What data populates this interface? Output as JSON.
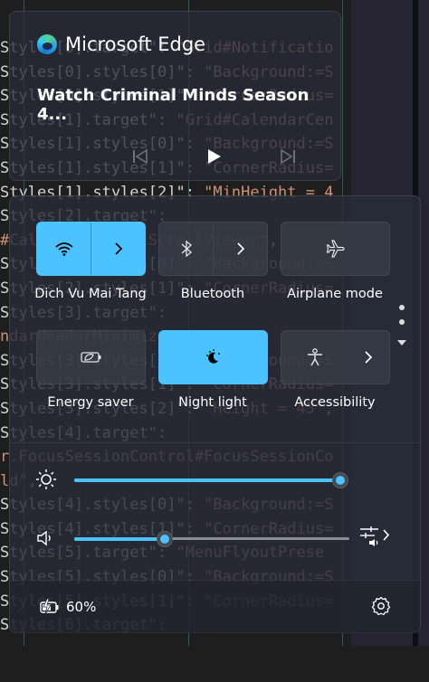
{
  "background_editor": {
    "lines": [
      [
        {
          "t": "Styles[0].target\": ",
          "c": "w"
        },
        {
          "t": "\"Grid#Notificatio",
          "c": "o"
        }
      ],
      [
        {
          "t": "Styles[0].styles[0]\": ",
          "c": "w"
        },
        {
          "t": "\"Background:=S",
          "c": "o"
        }
      ],
      [
        {
          "t": "Styles[0].styles[1]\": ",
          "c": "w"
        },
        {
          "t": "\"CornerRadius=",
          "c": "o"
        }
      ],
      [
        {
          "t": "Styles[1].target\": ",
          "c": "w"
        },
        {
          "t": "\"Grid#CalendarCen",
          "c": "o"
        }
      ],
      [
        {
          "t": "Styles[1].styles[0]\": ",
          "c": "w"
        },
        {
          "t": "\"Background:=S",
          "c": "o"
        }
      ],
      [
        {
          "t": "Styles[1].styles[1]\": ",
          "c": "w"
        },
        {
          "t": "\"CornerRadius=",
          "c": "o"
        }
      ],
      [
        {
          "t": "Styles[1].styles[2]\": ",
          "c": "w"
        },
        {
          "t": "\"MinHeight = 4",
          "c": "o"
        }
      ],
      [
        {
          "t": "Styles[2].target\":",
          "c": "w"
        }
      ],
      [
        {
          "t": "#CalendarControlScrollViewer\"",
          "c": "o"
        },
        {
          "t": ",",
          "c": "w"
        }
      ],
      [
        {
          "t": "Styles[2].styles[0]\": ",
          "c": "w"
        },
        {
          "t": "\"Background:=S",
          "c": "o"
        }
      ],
      [
        {
          "t": "Styles[2].styles[1]\": ",
          "c": "w"
        },
        {
          "t": "\"CornerRadius=",
          "c": "o"
        }
      ],
      [
        {
          "t": "Styles[3].target\":",
          "c": "w"
        }
      ],
      [
        {
          "t": "ndarHeaderMinimiz",
          "c": "o"
        }
      ],
      [
        {
          "t": "Styles[3].styles[0]\": ",
          "c": "w"
        },
        {
          "t": "\"Background:=S",
          "c": "o"
        }
      ],
      [
        {
          "t": "Styles[3].styles[1]\": ",
          "c": "w"
        },
        {
          "t": "\"CornerRadius=",
          "c": "o"
        }
      ],
      [
        {
          "t": "Styles[3].styles[2]\": ",
          "c": "w"
        },
        {
          "t": "\"Height = 45\"",
          "c": "o"
        },
        {
          "t": ",",
          "c": "w"
        }
      ],
      [
        {
          "t": "Styles[4].target\":",
          "c": "w"
        }
      ],
      [
        {
          "t": "r.FocusSessionControl#FocusSessionCo",
          "c": "o"
        }
      ],
      [
        {
          "t": "ld\"",
          "c": "o"
        },
        {
          "t": ",",
          "c": "w"
        }
      ],
      [
        {
          "t": "Styles[4].styles[0]\": ",
          "c": "w"
        },
        {
          "t": "\"Background:=S",
          "c": "o"
        }
      ],
      [
        {
          "t": "Styles[4].styles[1]\": ",
          "c": "w"
        },
        {
          "t": "\"CornerRadius=",
          "c": "o"
        }
      ],
      [
        {
          "t": "Styles[5].target\": ",
          "c": "w"
        },
        {
          "t": "\"MenuFlyoutPrese",
          "c": "o"
        }
      ],
      [
        {
          "t": "Styles[5].styles[0]\": ",
          "c": "w"
        },
        {
          "t": "\"Background:=S",
          "c": "o"
        }
      ],
      [
        {
          "t": "Styles[5].styles[1]\": ",
          "c": "w"
        },
        {
          "t": "\"CornerRadius=",
          "c": "o"
        }
      ],
      [
        {
          "t": "Styles[6].target\":",
          "c": "w"
        }
      ]
    ]
  },
  "media": {
    "app_name": "Microsoft Edge",
    "app_icon": "edge-logo-icon",
    "title": "Watch Criminal Minds Season 4...",
    "controls": [
      "previous-track-icon",
      "play-icon",
      "next-track-icon"
    ]
  },
  "quick_settings": {
    "tiles": [
      {
        "label": "Dich Vu Mai Tang",
        "icon": "wifi-icon",
        "state": "on",
        "has_chevron": true
      },
      {
        "label": "Bluetooth",
        "icon": "bluetooth-icon",
        "state": "off",
        "has_chevron": true
      },
      {
        "label": "Airplane mode",
        "icon": "airplane-icon",
        "state": "off",
        "has_chevron": false
      },
      {
        "label": "Energy saver",
        "icon": "energy-saver-icon",
        "state": "off",
        "has_chevron": false
      },
      {
        "label": "Night light",
        "icon": "night-light-icon",
        "state": "on",
        "has_chevron": false
      },
      {
        "label": "Accessibility",
        "icon": "accessibility-icon",
        "state": "off",
        "has_chevron": true
      }
    ],
    "pager": {
      "pages": 2,
      "current": 1
    },
    "brightness": {
      "icon": "brightness-icon",
      "value": 100
    },
    "volume": {
      "icon": "speaker-icon",
      "value": 33,
      "output_icon": "audio-output-icon"
    },
    "battery": {
      "icon": "battery-charging-icon",
      "text": "60%"
    },
    "settings_icon": "settings-gear-icon"
  },
  "colors": {
    "accent": "#4cc2ff",
    "panel": "#282c38",
    "editor_bg": "#1e1e1e",
    "code_string": "#ce9178"
  }
}
